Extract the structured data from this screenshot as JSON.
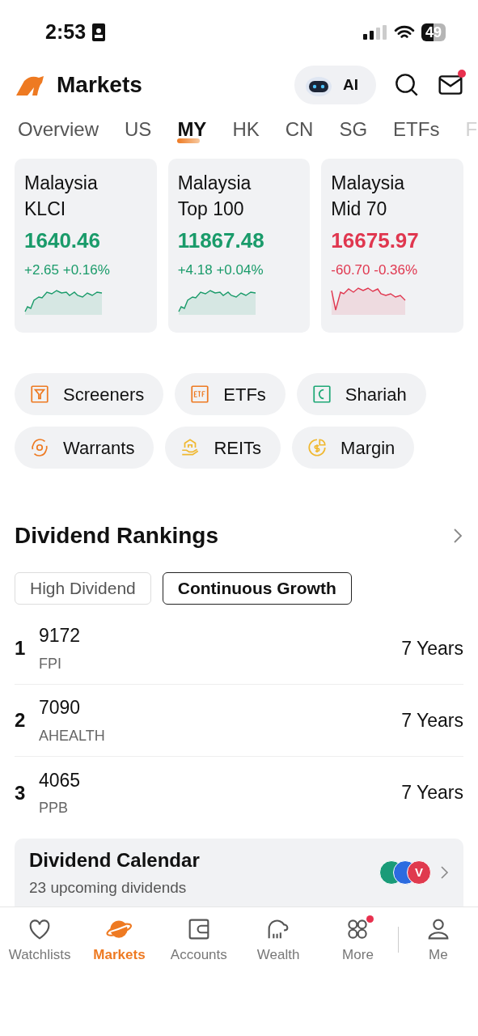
{
  "status_bar": {
    "time": "2:53",
    "battery": "49"
  },
  "header": {
    "title": "Markets",
    "ai_label": "AI",
    "mail_unread": true
  },
  "tabs": [
    {
      "label": "Overview",
      "selected": false
    },
    {
      "label": "US",
      "selected": false
    },
    {
      "label": "MY",
      "selected": true
    },
    {
      "label": "HK",
      "selected": false
    },
    {
      "label": "CN",
      "selected": false
    },
    {
      "label": "SG",
      "selected": false
    },
    {
      "label": "ETFs",
      "selected": false
    },
    {
      "label": "F",
      "selected": false
    }
  ],
  "indices": [
    {
      "name": "Malaysia KLCI",
      "price": "1640.46",
      "change": "+2.65 +0.16%",
      "kind": "up"
    },
    {
      "name": "Malaysia Top 100",
      "price": "11867.48",
      "change": "+4.18 +0.04%",
      "kind": "up"
    },
    {
      "name": "Malaysia Mid 70",
      "price": "16675.97",
      "change": "-60.70 -0.36%",
      "kind": "down"
    }
  ],
  "shortcuts": [
    [
      {
        "label": "Screeners",
        "kind": "filter"
      },
      {
        "label": "ETFs",
        "kind": "etf"
      },
      {
        "label": "Shariah",
        "kind": "moon"
      }
    ],
    [
      {
        "label": "Warrants",
        "kind": "warrant"
      },
      {
        "label": "REITs",
        "kind": "house"
      },
      {
        "label": "Margin",
        "kind": "coin"
      }
    ]
  ],
  "dividend_rankings": {
    "title": "Dividend Rankings",
    "filters": [
      {
        "label": "High Dividend",
        "selected": false
      },
      {
        "label": "Continuous Growth",
        "selected": true
      }
    ],
    "rows": [
      {
        "rank": "1",
        "code": "9172",
        "name": "FPI",
        "years": "7 Years"
      },
      {
        "rank": "2",
        "code": "7090",
        "name": "AHEALTH",
        "years": "7 Years"
      },
      {
        "rank": "3",
        "code": "4065",
        "name": "PPB",
        "years": "7 Years"
      }
    ]
  },
  "dividend_calendar": {
    "title": "Dividend Calendar",
    "subtitle": "23 upcoming dividends",
    "avatars": [
      {
        "color": "#1a9b78"
      },
      {
        "color": "#2c6be0"
      },
      {
        "color": "#e03a4e",
        "letter": "V"
      }
    ]
  },
  "bottom_nav": [
    {
      "label": "Watchlists",
      "kind": "heart",
      "selected": false,
      "badge": false
    },
    {
      "label": "Markets",
      "kind": "planet",
      "selected": true,
      "badge": false
    },
    {
      "label": "Accounts",
      "kind": "wallet",
      "selected": false,
      "badge": false
    },
    {
      "label": "Wealth",
      "kind": "elephant",
      "selected": false,
      "badge": false
    },
    {
      "label": "More",
      "kind": "grid",
      "selected": false,
      "badge": true
    },
    {
      "label": "Me",
      "kind": "person",
      "selected": false,
      "badge": false
    }
  ]
}
